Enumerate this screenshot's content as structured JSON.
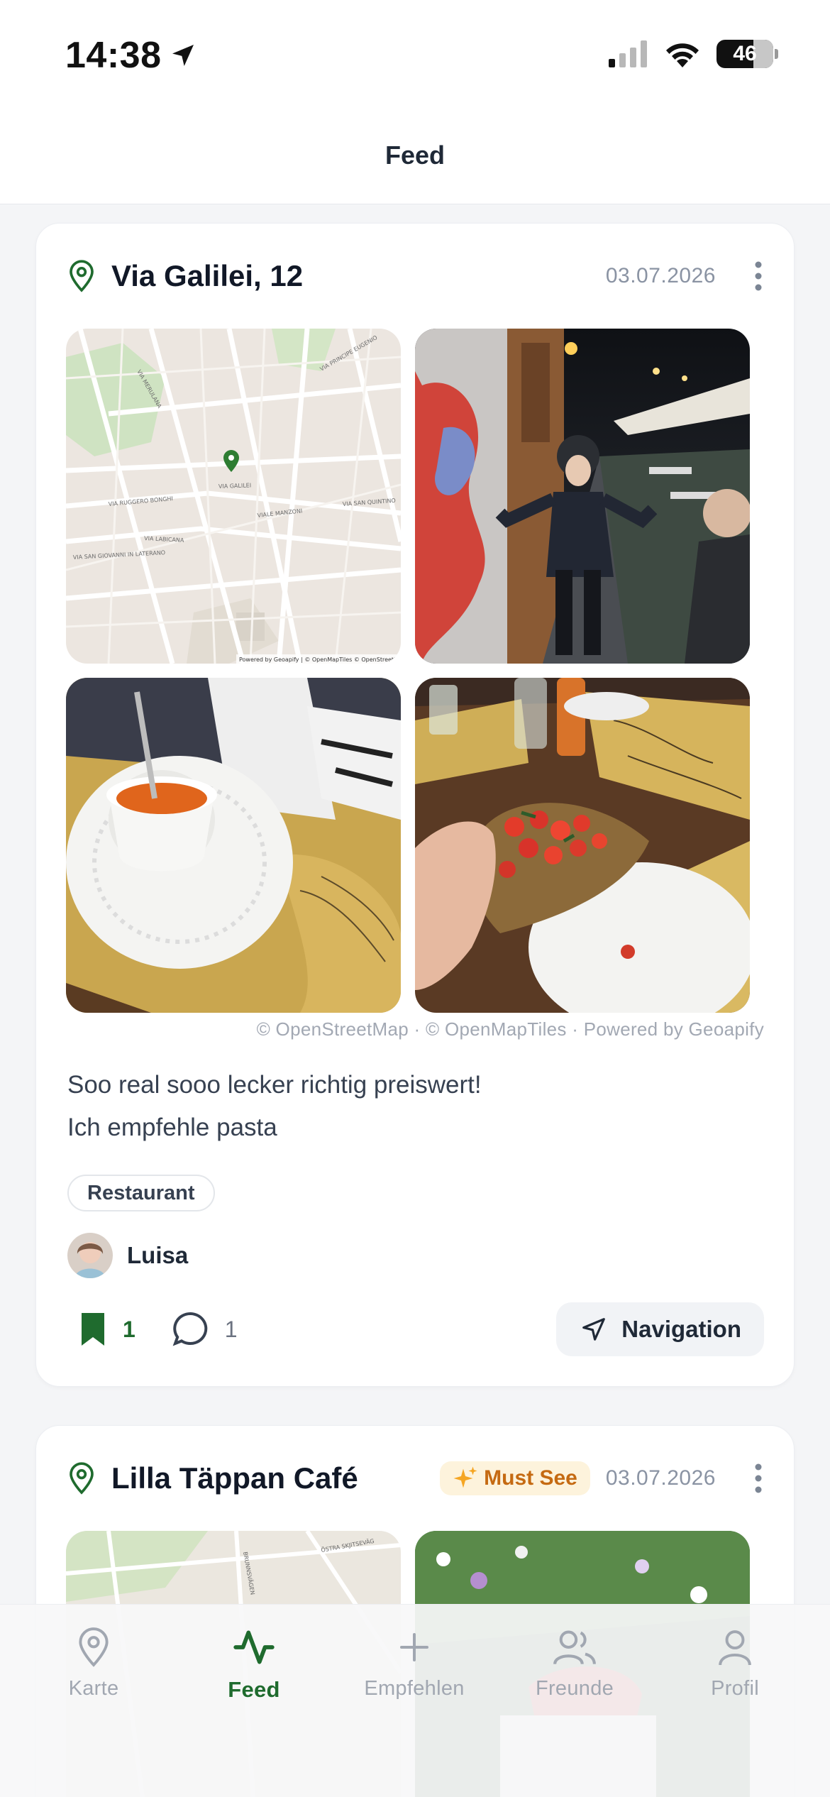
{
  "status_bar": {
    "time": "14:38",
    "battery": "46"
  },
  "header": {
    "title": "Feed"
  },
  "posts": [
    {
      "place": "Via Galilei, 12",
      "date": "03.07.2026",
      "attribution": "© OpenStreetMap · © OpenMapTiles · Powered by Geoapify",
      "map_credit": "Powered by Geoapify | © OpenMapTiles © OpenStreetMap",
      "map_streets": [
        "VIA MERULANA",
        "VIA PRINCIPE EUGENIO",
        "VIA RUGGERO BONGHI",
        "VIA GALILEI",
        "VIALE MANZONI",
        "VIA LABICANA",
        "VIA SAN GIOVANNI IN LATERANO",
        "VIA SAN QUINTINO"
      ],
      "description_lines": [
        "Soo real sooo lecker richtig preiswert!",
        "Ich empfehle pasta"
      ],
      "category": "Restaurant",
      "author": "Luisa",
      "saves": "1",
      "comments": "1",
      "navigation_label": "Navigation"
    },
    {
      "place": "Lilla Täppan Café",
      "badge": "Must See",
      "date": "03.07.2026",
      "map_streets": [
        "BRUNNSVÄGEN",
        "ÖSTRA SKJITSEVÄG"
      ]
    }
  ],
  "tabs": [
    {
      "label": "Karte",
      "icon": "map-pin-icon"
    },
    {
      "label": "Feed",
      "icon": "activity-icon",
      "active": true
    },
    {
      "label": "Empfehlen",
      "icon": "plus-icon"
    },
    {
      "label": "Freunde",
      "icon": "users-icon"
    },
    {
      "label": "Profil",
      "icon": "user-icon"
    }
  ],
  "colors": {
    "accent_green": "#1f6b2e",
    "badge_orange": "#c56a12",
    "muted_gray": "#8a93a3"
  }
}
